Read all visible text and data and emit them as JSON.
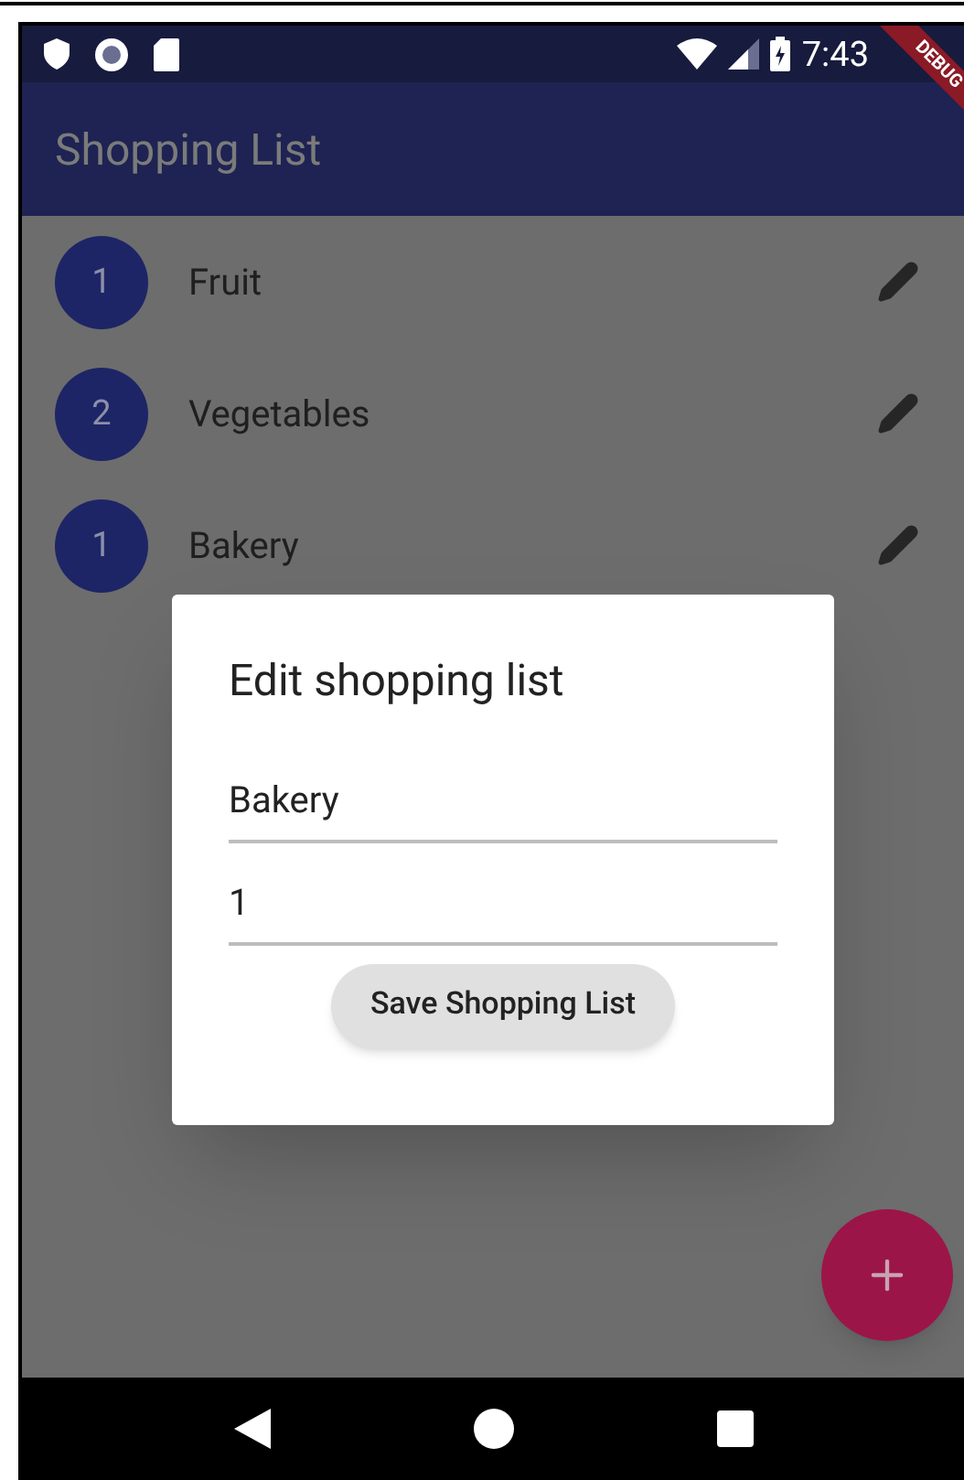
{
  "status_bar": {
    "time": "7:43"
  },
  "debug_banner": "DEBUG",
  "app_bar": {
    "title": "Shopping List"
  },
  "lists": [
    {
      "count": "1",
      "name": "Fruit"
    },
    {
      "count": "2",
      "name": "Vegetables"
    },
    {
      "count": "1",
      "name": "Bakery"
    }
  ],
  "dialog": {
    "title": "Edit shopping list",
    "fields": [
      {
        "value": "Bakery"
      },
      {
        "value": "1"
      }
    ],
    "button": "Save Shopping List"
  }
}
